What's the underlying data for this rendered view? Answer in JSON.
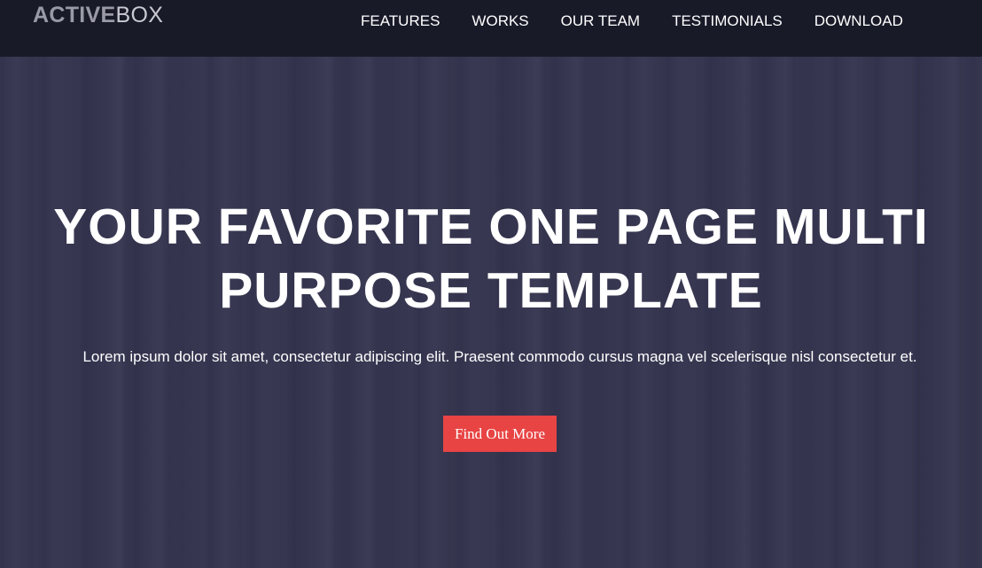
{
  "brand": {
    "logo_bold": "ACTIVE",
    "logo_light": "BOX"
  },
  "nav": {
    "items": [
      {
        "label": "FEATURES"
      },
      {
        "label": "WORKS"
      },
      {
        "label": "OUR TEAM"
      },
      {
        "label": "TESTIMONIALS"
      },
      {
        "label": "DOWNLOAD"
      }
    ]
  },
  "hero": {
    "headline": "YOUR FAVORITE ONE PAGE MULTI PURPOSE TEMPLATE",
    "subtitle": "Lorem ipsum dolor sit amet, consectetur adipiscing elit. Praesent commodo cursus magna vel scelerisque nisl consectetur et.",
    "cta_label": "Find Out More"
  },
  "colors": {
    "navbar_bg": "#181a28",
    "hero_bg": "#34344f",
    "accent": "#e84444",
    "text": "#ffffff"
  }
}
